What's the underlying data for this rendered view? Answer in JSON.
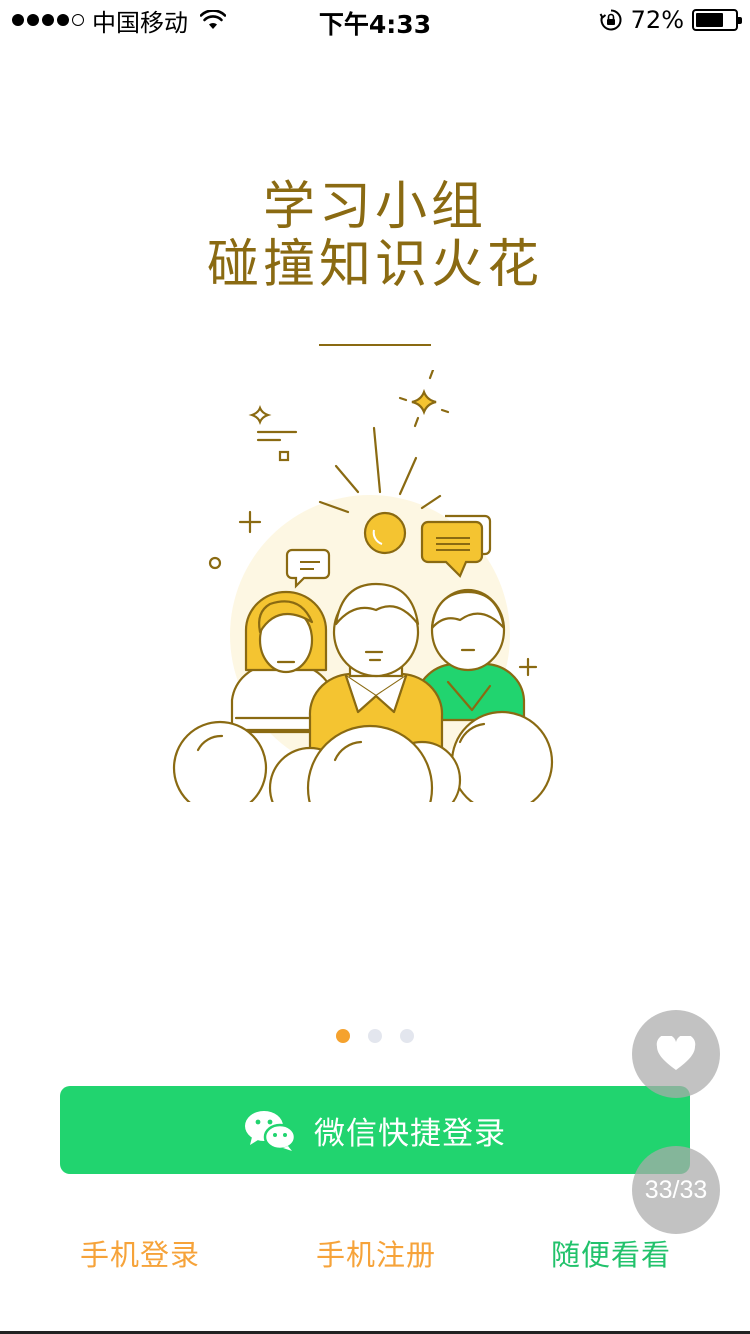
{
  "status_bar": {
    "carrier": "中国移动",
    "time": "下午4:33",
    "battery_percent": "72%",
    "battery_level": 0.72,
    "icons": [
      "signal-dots-icon",
      "wifi-icon",
      "rotation-lock-icon",
      "battery-icon"
    ]
  },
  "hero": {
    "line1": "学习小组",
    "line2": "碰撞知识火花",
    "illustration": "study-group-people-illustration"
  },
  "pager": {
    "count": 3,
    "active_index": 0
  },
  "actions": {
    "wechat_login_label": "微信快捷登录",
    "wechat_icon": "wechat-icon",
    "phone_login_label": "手机登录",
    "phone_register_label": "手机注册",
    "browse_label": "随便看看"
  },
  "overlay": {
    "favorite_icon": "heart-icon",
    "counter_label": "33/33"
  },
  "colors": {
    "brand_green": "#21d46f",
    "accent_orange": "#f6a33a",
    "headline_brown": "#8a6a12",
    "browse_green": "#21c26b"
  }
}
